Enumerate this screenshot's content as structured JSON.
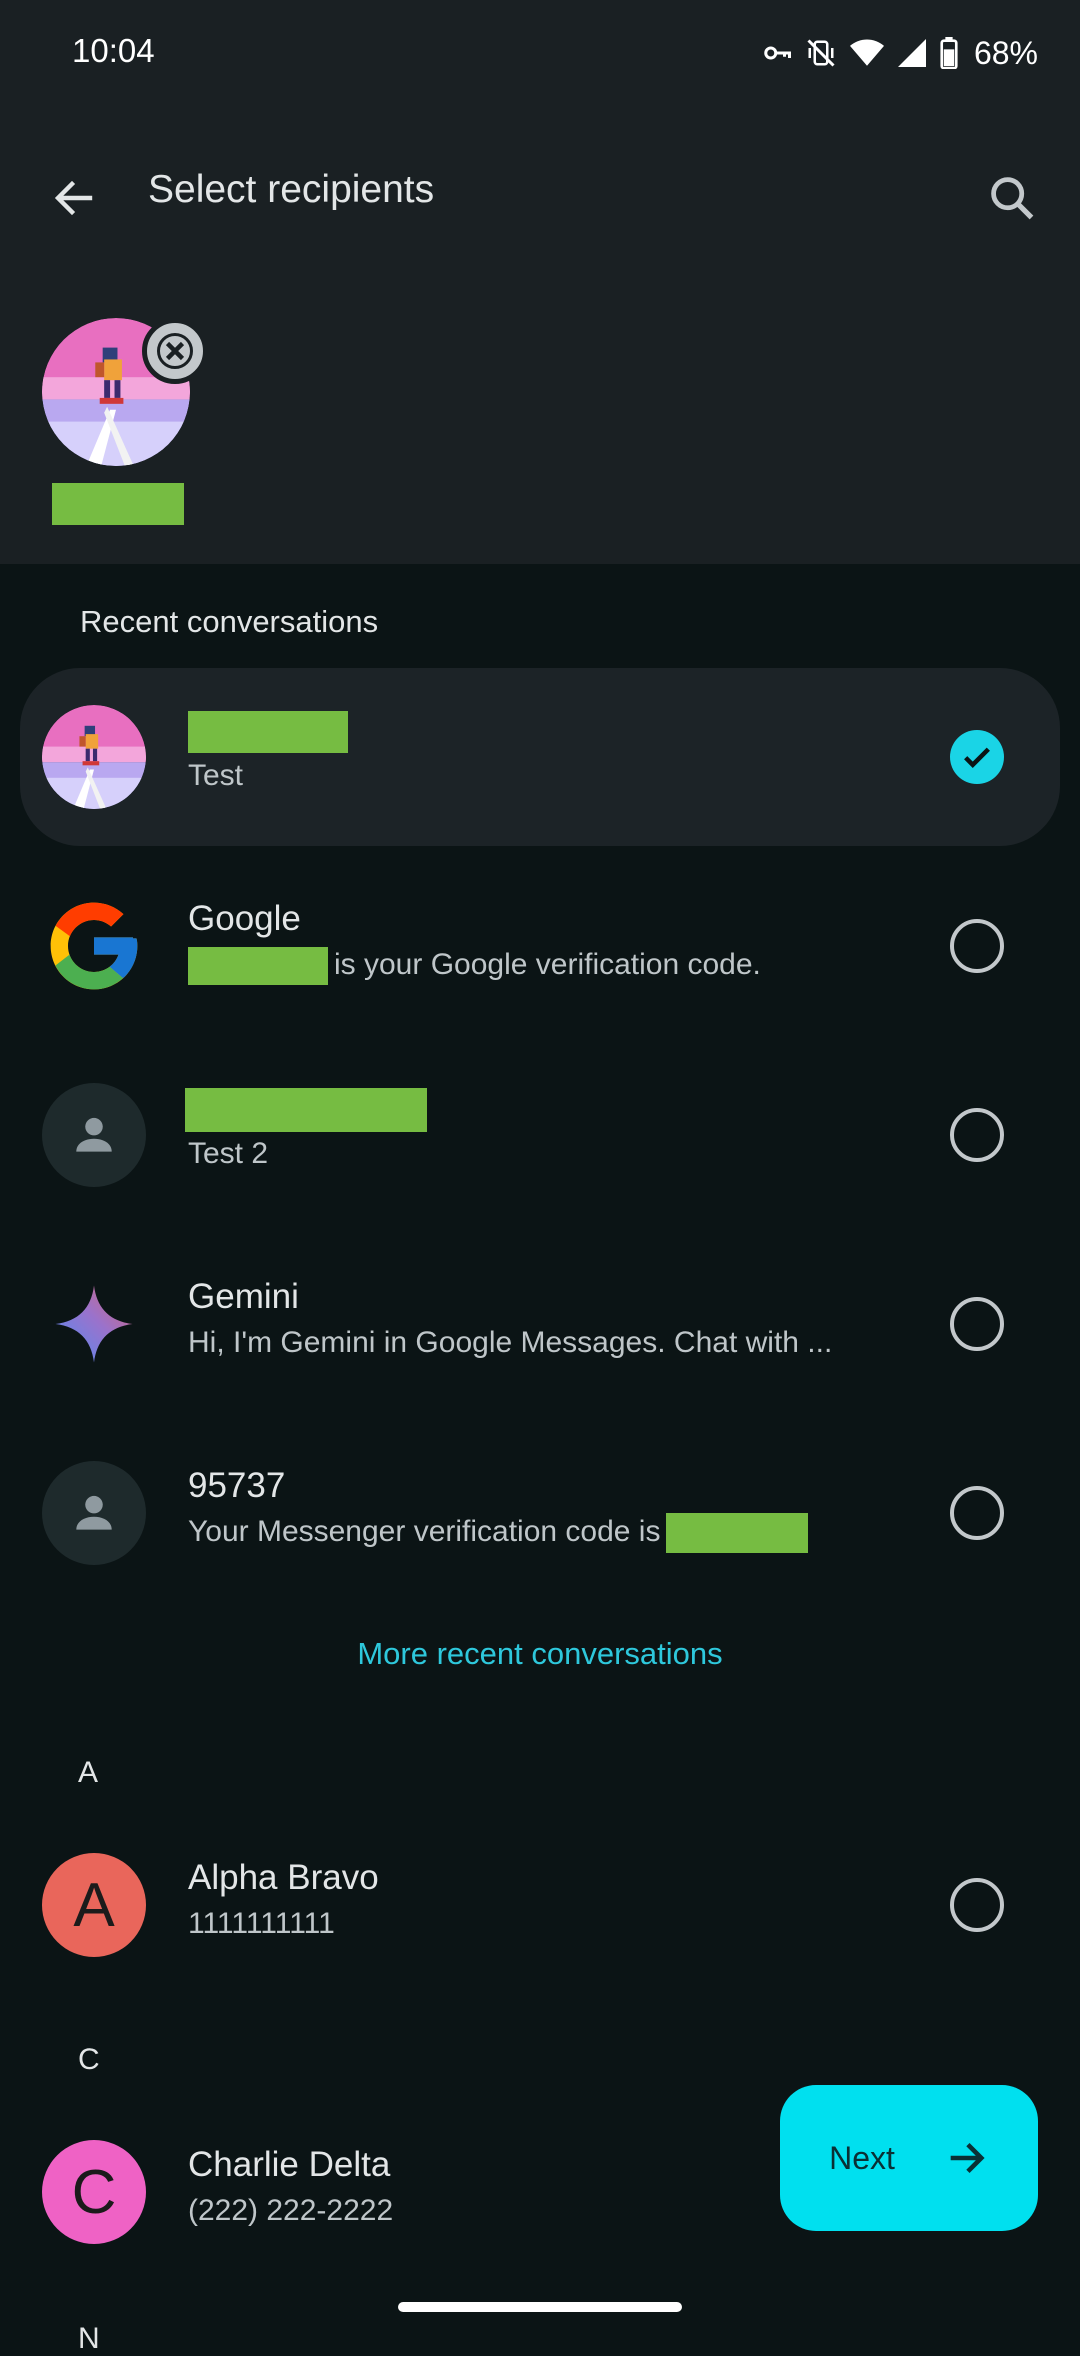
{
  "status_bar": {
    "time": "10:04",
    "battery": "68%",
    "icons": [
      "vpn-key-icon",
      "vibrate-off-icon",
      "wifi-icon",
      "signal-icon",
      "battery-icon"
    ]
  },
  "app_bar": {
    "title": "Select recipients",
    "back_icon": "arrow-back-icon",
    "search_icon": "search-icon"
  },
  "selected_recipients": [
    {
      "name_redacted": true,
      "avatar": "pixel-art-jetpack"
    }
  ],
  "recent_section": {
    "label": "Recent conversations",
    "items": [
      {
        "name": "",
        "name_redacted": true,
        "subtitle": "Test",
        "selected": true,
        "avatar": "pixel-art-jetpack"
      },
      {
        "name": "Google",
        "subtitle": "is your Google verification code.",
        "subtitle_prefix_redacted": true,
        "selected": false,
        "avatar": "google-logo"
      },
      {
        "name": "",
        "name_redacted": true,
        "subtitle": "Test 2",
        "selected": false,
        "avatar": "person-icon"
      },
      {
        "name": "Gemini",
        "subtitle": "Hi, I'm Gemini in Google Messages. Chat with ...",
        "selected": false,
        "avatar": "gemini-sparkle"
      },
      {
        "name": "95737",
        "subtitle": "Your Messenger verification code is",
        "subtitle_suffix_redacted": true,
        "selected": false,
        "avatar": "person-icon"
      }
    ],
    "more_link": "More recent conversations"
  },
  "contacts": [
    {
      "letter": "A",
      "items": [
        {
          "name": "Alpha Bravo",
          "subtitle": "1111111111",
          "initial": "A",
          "color": "#e9665b",
          "selected": false
        }
      ]
    },
    {
      "letter": "C",
      "items": [
        {
          "name": "Charlie Delta",
          "subtitle": "(222) 222-2222",
          "initial": "C",
          "color": "#ef62c5",
          "selected": false
        }
      ]
    },
    {
      "letter": "N",
      "items": []
    }
  ],
  "next_button": {
    "label": "Next",
    "icon": "arrow-forward-icon"
  },
  "colors": {
    "accent": "#00e0ef",
    "link": "#2ec8dc",
    "redaction": "#76bc42",
    "background": "#0b1415",
    "header_background": "#1a2023"
  }
}
